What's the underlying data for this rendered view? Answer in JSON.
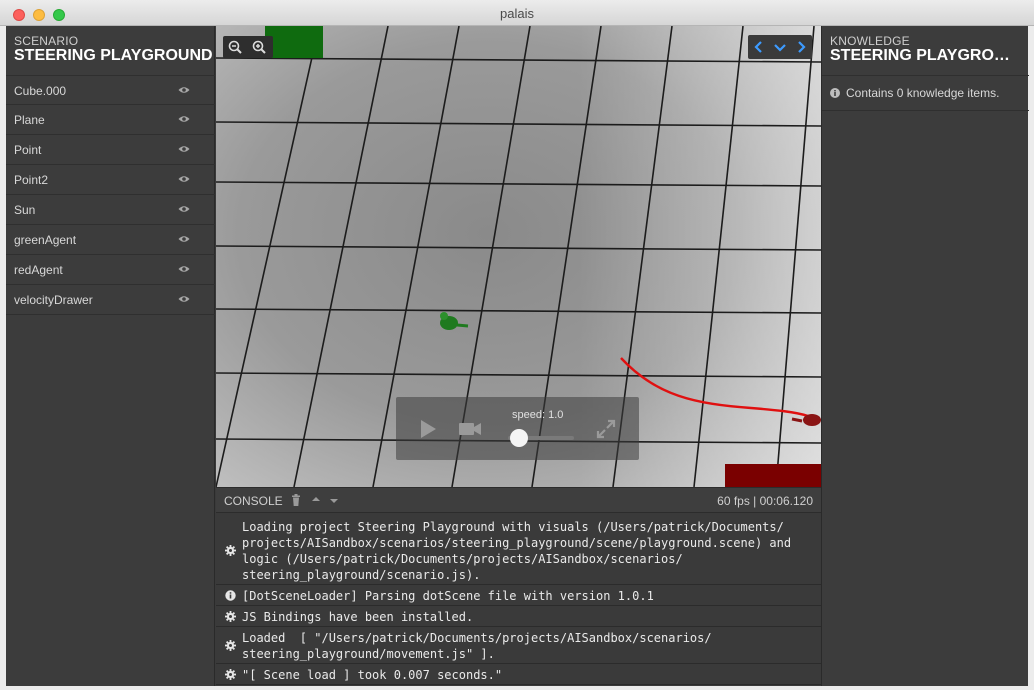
{
  "window": {
    "title": "palais"
  },
  "left_panel": {
    "section_label": "SCENARIO",
    "title": "STEERING PLAYGROUND",
    "items": [
      {
        "label": "Cube.000"
      },
      {
        "label": "Plane"
      },
      {
        "label": "Point"
      },
      {
        "label": "Point2"
      },
      {
        "label": "Sun"
      },
      {
        "label": "greenAgent"
      },
      {
        "label": "redAgent"
      },
      {
        "label": "velocityDrawer"
      }
    ]
  },
  "right_panel": {
    "section_label": "KNOWLEDGE",
    "title": "STEERING PLAYGROUND",
    "info_text": "Contains 0 knowledge items."
  },
  "viewport": {
    "speed_label": "speed: 1.0",
    "speed_value": 0.0,
    "colors": {
      "green_agent": "#1f7a1f",
      "red_agent": "#8a1414",
      "trail": "#e01010",
      "green_box": "#0f6b0f",
      "red_box": "#7a0000"
    }
  },
  "console": {
    "label": "CONSOLE",
    "status": "60 fps | 00:06.120",
    "entries": [
      {
        "icon": "gear-icon",
        "lines": [
          "Loading project Steering Playground with visuals (/Users/patrick/Documents/",
          "projects/AISandbox/scenarios/steering_playground/scene/playground.scene) and",
          "logic (/Users/patrick/Documents/projects/AISandbox/scenarios/",
          "steering_playground/scenario.js)."
        ]
      },
      {
        "icon": "info-icon",
        "lines": [
          "[DotSceneLoader] Parsing dotScene file with version 1.0.1"
        ]
      },
      {
        "icon": "gear-icon",
        "lines": [
          "JS Bindings have been installed."
        ]
      },
      {
        "icon": "gear-icon",
        "lines": [
          "Loaded  [ \"/Users/patrick/Documents/projects/AISandbox/scenarios/",
          "steering_playground/movement.js\" ]."
        ]
      },
      {
        "icon": "gear-icon",
        "lines": [
          "\"[ Scene load ] took 0.007 seconds.\""
        ]
      }
    ]
  }
}
